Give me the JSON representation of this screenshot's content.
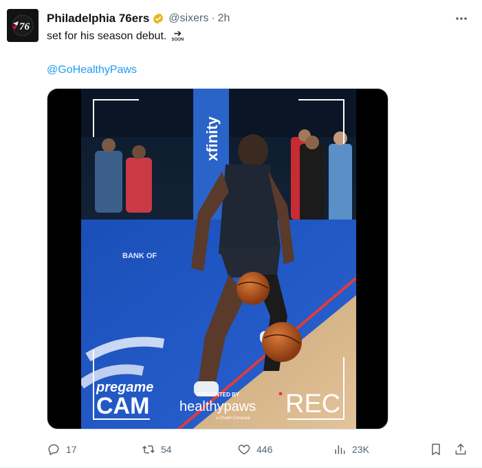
{
  "tweet": {
    "display_name": "Philadelphia 76ers",
    "handle": "@sixers",
    "separator": "·",
    "time": "2h",
    "text": "set for his season debut.",
    "emoji_soon_label": "SOON",
    "mention": "@GoHealthyPaws"
  },
  "media": {
    "overlay_pregame": "pregame",
    "overlay_cam": "CAM",
    "overlay_presented": "PRESENTED BY",
    "overlay_sponsor": "healthypaws",
    "overlay_sponsor_sub": "a Chubb Company",
    "overlay_rec": "REC",
    "banner_text": "xfinity",
    "court_text": "BANK OF"
  },
  "actions": {
    "replies": "17",
    "reposts": "54",
    "likes": "446",
    "views": "23K"
  },
  "colors": {
    "accent": "#1d9bf0",
    "text_primary": "#0f1419",
    "text_secondary": "#536471",
    "verified_gold": "#e2b719"
  }
}
